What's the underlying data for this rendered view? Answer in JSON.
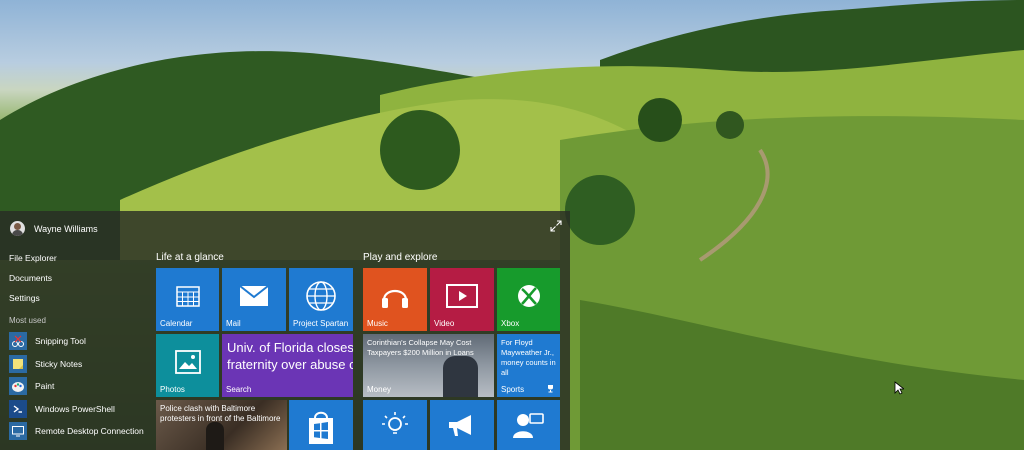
{
  "user": {
    "name": "Wayne Williams"
  },
  "places": [
    "File Explorer",
    "Documents",
    "Settings"
  ],
  "most_used_label": "Most used",
  "most_used": [
    {
      "label": "Snipping Tool",
      "icon": "scissors-icon"
    },
    {
      "label": "Sticky Notes",
      "icon": "sticky-note-icon"
    },
    {
      "label": "Paint",
      "icon": "paint-palette-icon"
    },
    {
      "label": "Windows PowerShell",
      "icon": "powershell-icon"
    },
    {
      "label": "Remote Desktop Connection",
      "icon": "remote-desktop-icon"
    }
  ],
  "groups": {
    "life": {
      "title": "Life at a glance",
      "calendar": "Calendar",
      "mail": "Mail",
      "spartan": "Project Spartan",
      "photos": "Photos",
      "news_headline_1": "Univ. of Florida closes",
      "news_headline_2": "fraternity over abuse c",
      "news_label": "Search",
      "police_headline": "Police clash with Baltimore protesters in front of the Baltimore"
    },
    "play": {
      "title": "Play and explore",
      "music": "Music",
      "video": "Video",
      "xbox": "Xbox",
      "money_headline": "Corinthian's Collapse May Cost Taxpayers $200 Million in Loans",
      "money": "Money",
      "sports_headline": "For Floyd Mayweather Jr., money counts in all",
      "sports": "Sports"
    }
  },
  "colors": {
    "blue": "#1f7ad1",
    "teal": "#0d8f9c",
    "purple": "#6b35b5",
    "orange": "#e0531f",
    "red": "#b51c44",
    "green": "#179b2c",
    "tip_blue": "#1f7ad1"
  }
}
